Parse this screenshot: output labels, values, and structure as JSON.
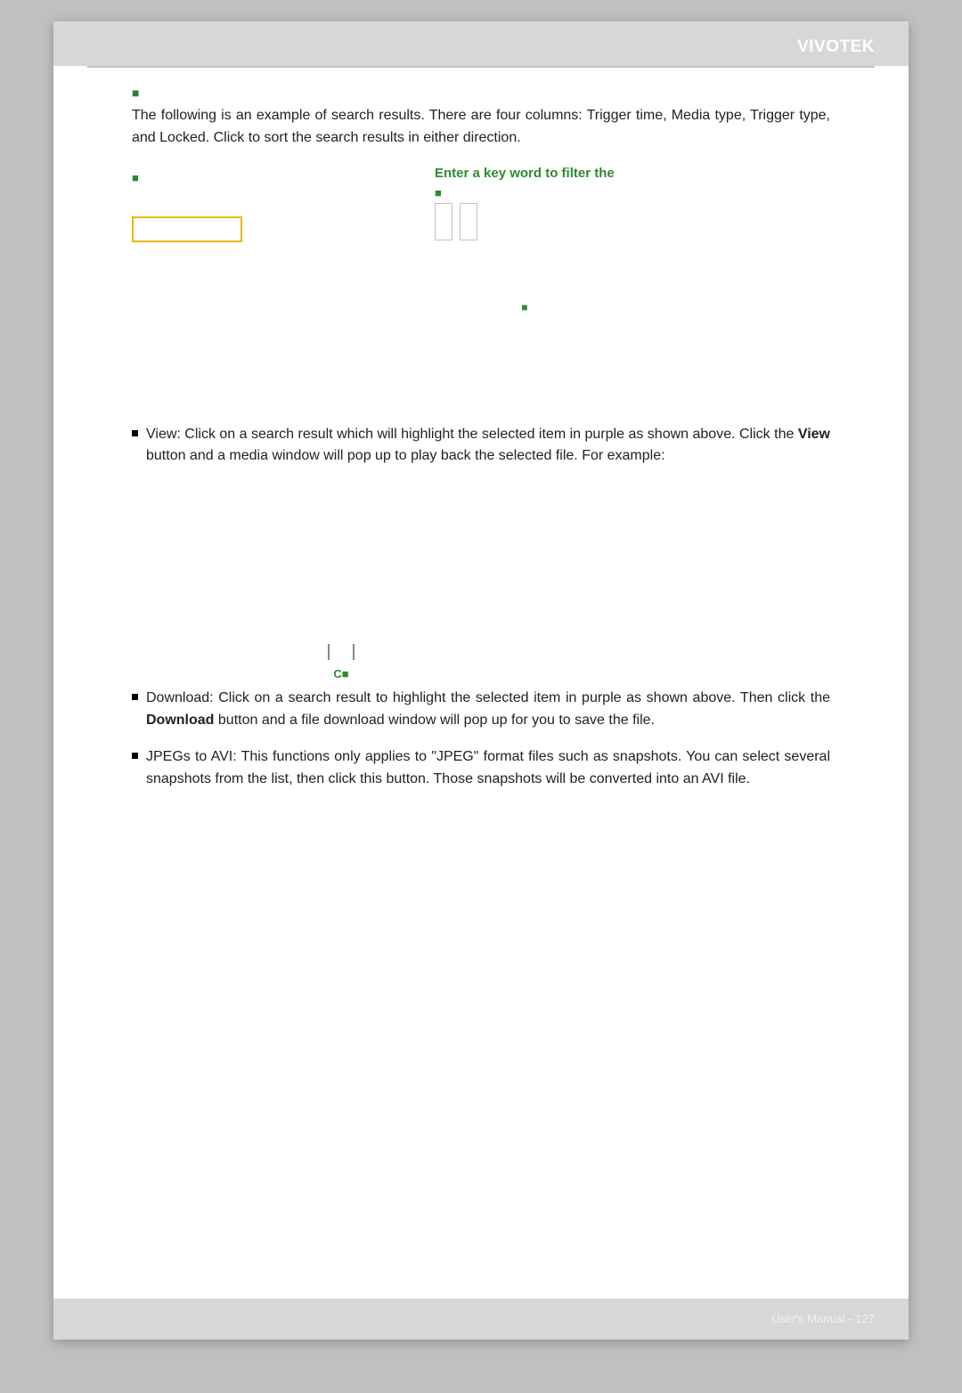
{
  "header": {
    "brand": "VIVOTEK"
  },
  "intro": {
    "resultsMarker": "■",
    "para1_a": "The following is an example of search results. There are four columns: Trigger time, Media type, Trigger type, and Locked. Click ",
    "para1_b": " to sort the search results in either direction."
  },
  "figure": {
    "leftMarker": "■",
    "filterCaption": "Enter a key word to filter the",
    "filterMarker": "■",
    "highlightMarker": "■"
  },
  "bullets": {
    "view_a": "View: Click on a search result which will highlight the selected item in purple as shown above. Click the ",
    "view_boldWord": "View",
    "view_b": " button and a media window will pop up to play back the selected file. For example:",
    "videoCaption": "C■",
    "download_a": "Download: Click on a search result to highlight the selected item in purple as shown above. Then click the ",
    "download_boldWord": "Download",
    "download_b": " button and a file download window will pop up for you to save the file.",
    "jpegs": "JPEGs to AVI: This functions only applies to \"JPEG\" format files such as snapshots. You can select several snapshots from the list, then click this button. Those snapshots will be converted into an AVI file."
  },
  "footer": {
    "text": "User's Manual - 127"
  }
}
